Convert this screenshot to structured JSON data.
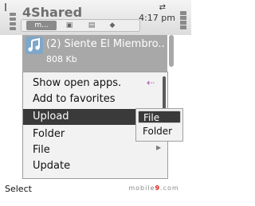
{
  "header": {
    "app_title": "4Shared",
    "time": "4:17 pm",
    "tabs": [
      "m..."
    ]
  },
  "file": {
    "name": "(2) Siente El Miembro...",
    "size": "808 Kb",
    "icon": "music-note-icon"
  },
  "menu": {
    "items": [
      {
        "label": "Show open apps.",
        "icon": "arrow-icon"
      },
      {
        "label": "Add to favorites"
      },
      {
        "label": "Upload",
        "selected": true
      },
      {
        "label": "Folder"
      },
      {
        "label": "File",
        "has_submenu": true
      },
      {
        "label": "Update"
      }
    ]
  },
  "submenu": {
    "items": [
      {
        "label": "File",
        "selected": true
      },
      {
        "label": "Folder"
      }
    ]
  },
  "softkeys": {
    "left": "Select"
  },
  "watermark": {
    "prefix": "mobile",
    "nine": "9",
    "suffix": ".com"
  },
  "colors": {
    "header_bg": "#dcdcdc",
    "selected_bg": "#3a3a3a",
    "file_row_bg": "#a8a8a8"
  }
}
